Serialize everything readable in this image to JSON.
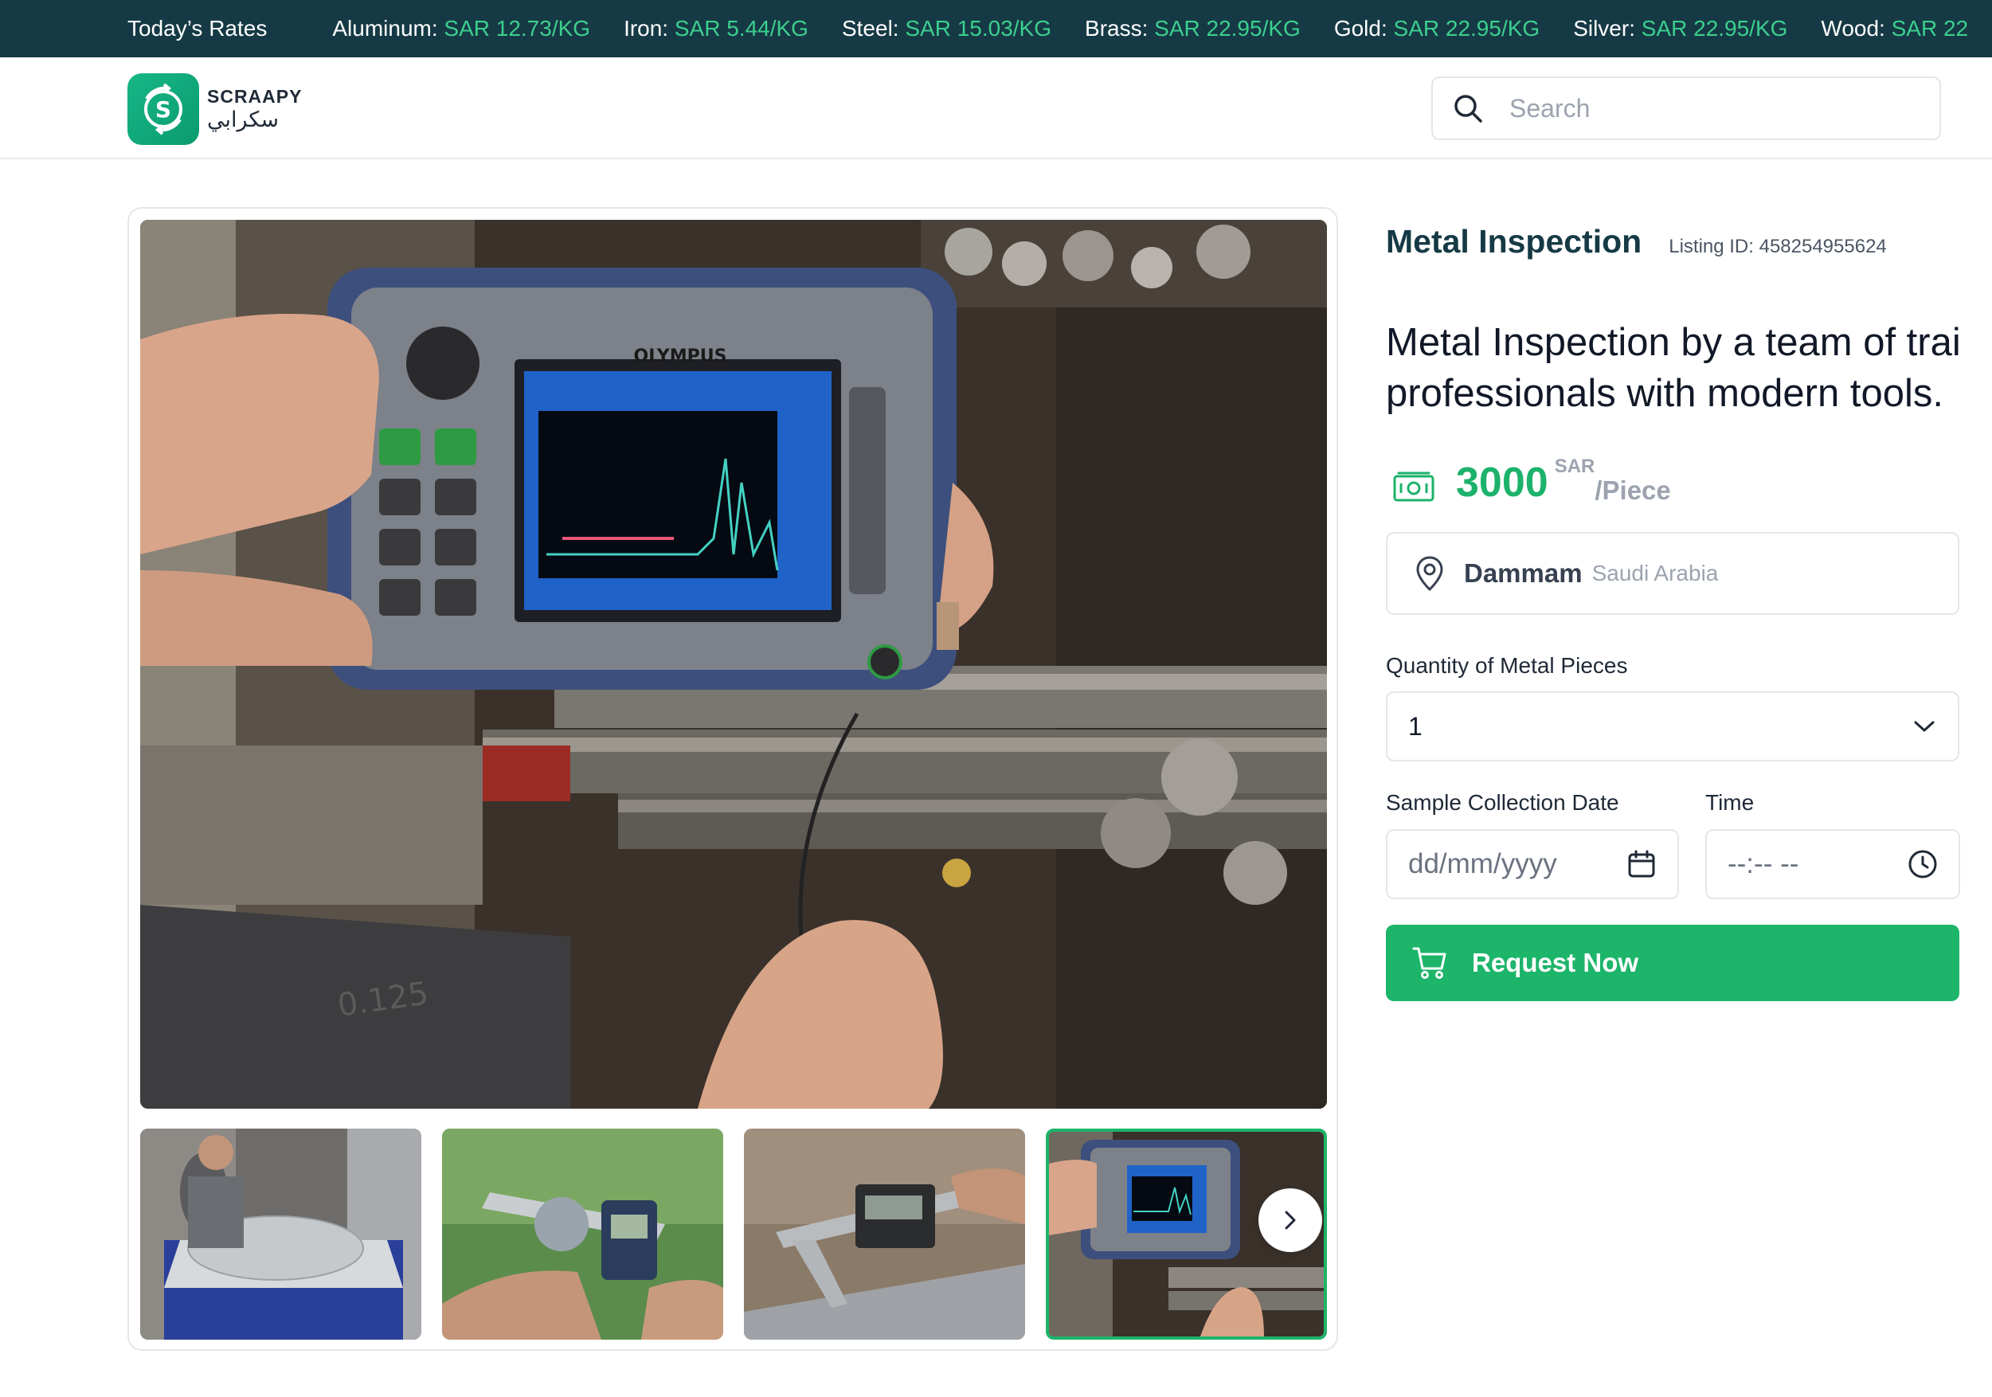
{
  "ticker": {
    "title": "Today’s Rates",
    "rates": [
      {
        "name": "Aluminum:",
        "value": "SAR 12.73/KG"
      },
      {
        "name": "Iron:",
        "value": "SAR 5.44/KG"
      },
      {
        "name": "Steel:",
        "value": "SAR 15.03/KG"
      },
      {
        "name": "Brass:",
        "value": "SAR 22.95/KG"
      },
      {
        "name": "Gold:",
        "value": "SAR 22.95/KG"
      },
      {
        "name": "Silver:",
        "value": "SAR 22.95/KG"
      },
      {
        "name": "Wood:",
        "value": "SAR 22"
      }
    ],
    "colors": {
      "background": "#163a45",
      "value": "#3ccf8e"
    }
  },
  "header": {
    "logo_en": "SCRAAPY",
    "logo_ar": "سكرابي",
    "search_placeholder": "Search"
  },
  "gallery": {
    "main_image": "ultrasonic-flaw-detector-photo",
    "thumbnails": [
      {
        "image": "worker-inspecting-plate-photo",
        "active": false
      },
      {
        "image": "caliper-measuring-pipe-photo",
        "active": false
      },
      {
        "image": "digital-caliper-photo",
        "active": false
      },
      {
        "image": "ultrasonic-flaw-detector-photo",
        "active": true
      }
    ]
  },
  "listing": {
    "title": "Metal Inspection",
    "id_label": "Listing ID: 458254955624",
    "description_line1": "Metal Inspection by a team of trai",
    "description_line2": "professionals with modern tools.",
    "price": "3000",
    "currency": "SAR",
    "unit": "/Piece",
    "city": "Dammam",
    "country": "Saudi Arabia"
  },
  "form": {
    "quantity_label": "Quantity of Metal Pieces",
    "quantity_value": "1",
    "date_label": "Sample Collection Date",
    "date_placeholder": "dd/mm/yyyy",
    "time_label": "Time",
    "time_placeholder": "--:-- --",
    "request_button": "Request Now"
  },
  "colors": {
    "accent": "#1db56a",
    "heading": "#163a45",
    "price": "#1cb26b"
  }
}
